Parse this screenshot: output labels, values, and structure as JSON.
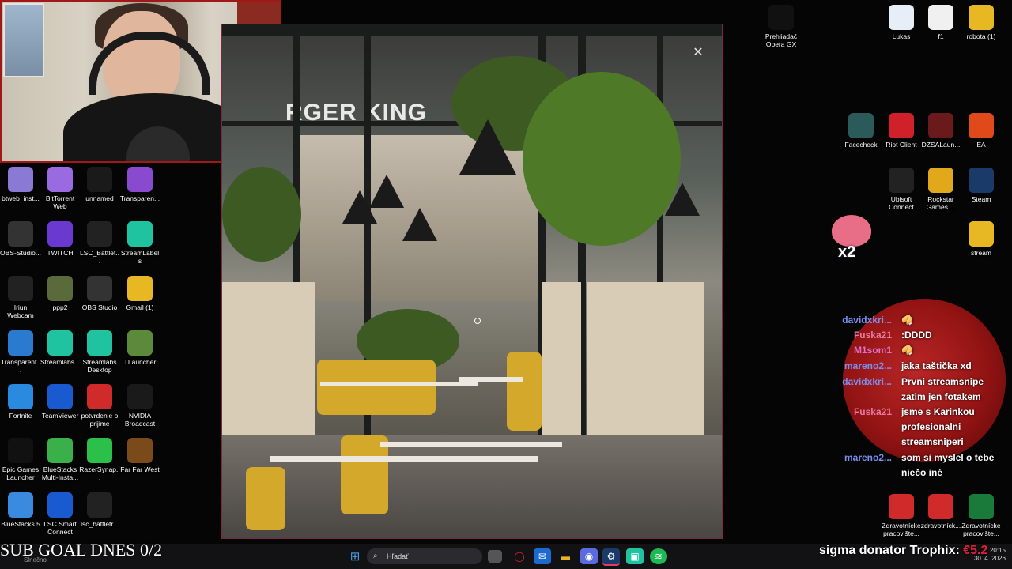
{
  "webcam": {
    "label": "webcam"
  },
  "viewer": {
    "sign": "RGER KING",
    "close": "✕"
  },
  "left_icons": [
    {
      "name": "btweb_inst...",
      "icon": "bittorrent-web-icon",
      "color": "#8a7ad6"
    },
    {
      "name": "BitTorrent Web",
      "icon": "bittorrent-web-icon",
      "color": "#9a6ae0"
    },
    {
      "name": "unnamed",
      "icon": "file-icon",
      "color": "#1a1a1a"
    },
    {
      "name": "Transparen...",
      "icon": "chat-bubble-icon",
      "color": "#8a4ad0"
    },
    {
      "name": "OBS-Studio...",
      "icon": "obs-icon",
      "color": "#333"
    },
    {
      "name": "TWITCH",
      "icon": "twitch-icon",
      "color": "#6a3ad0"
    },
    {
      "name": "LSC_Battlet...",
      "icon": "battlenet-icon",
      "color": "#222"
    },
    {
      "name": "StreamLabels",
      "icon": "streamlabs-icon",
      "color": "#1fc3a0"
    },
    {
      "name": "Iriun Webcam",
      "icon": "webcam-icon",
      "color": "#222"
    },
    {
      "name": "ppp2",
      "icon": "image-icon",
      "color": "#5a6a3a"
    },
    {
      "name": "OBS Studio",
      "icon": "obs-icon",
      "color": "#333"
    },
    {
      "name": "Gmail (1)",
      "icon": "folder-icon",
      "color": "#e8b824"
    },
    {
      "name": "Transparent...",
      "icon": "window-icon",
      "color": "#2a7ad0"
    },
    {
      "name": "Streamlabs...",
      "icon": "streamlabs-icon",
      "color": "#1fc3a0"
    },
    {
      "name": "Streamlabs Desktop",
      "icon": "streamlabs-icon",
      "color": "#1fc3a0"
    },
    {
      "name": "TLauncher",
      "icon": "minecraft-icon",
      "color": "#5a8a3a"
    },
    {
      "name": "Fortnite",
      "icon": "fortnite-icon",
      "color": "#2a8ae0"
    },
    {
      "name": "TeamViewer",
      "icon": "teamviewer-icon",
      "color": "#1a5ad0"
    },
    {
      "name": "potvrdenie o prijime",
      "icon": "pdf-icon",
      "color": "#d02a2a"
    },
    {
      "name": "NVIDIA Broadcast",
      "icon": "nvidia-icon",
      "color": "#1a1a1a"
    },
    {
      "name": "Epic Games Launcher",
      "icon": "epic-games-icon",
      "color": "#111"
    },
    {
      "name": "BlueStacks Multi-Insta...",
      "icon": "bluestacks-icon",
      "color": "#3ab04a"
    },
    {
      "name": "RazerSynap...",
      "icon": "razer-icon",
      "color": "#2ac04a"
    },
    {
      "name": "Far Far West",
      "icon": "game-icon",
      "color": "#7a4a1a"
    },
    {
      "name": "BlueStacks 5",
      "icon": "bluestacks-icon",
      "color": "#3a8ae0"
    },
    {
      "name": "LSC Smart Connect",
      "icon": "lsc-icon",
      "color": "#1a5ad0"
    },
    {
      "name": "lsc_battletr...",
      "icon": "battlenet-icon",
      "color": "#222"
    }
  ],
  "right_icons": [
    {
      "name": "Prehliadač Opera GX",
      "icon": "opera-gx-icon",
      "color": "#111"
    },
    {
      "name": "Lukas",
      "icon": "document-icon",
      "color": "#e8eef8"
    },
    {
      "name": "f1",
      "icon": "document-icon",
      "color": "#f0f0f0"
    },
    {
      "name": "robota (1)",
      "icon": "folder-icon",
      "color": "#e8b824"
    },
    {
      "name": "Facecheck",
      "icon": "facecheck-icon",
      "color": "#2a5a5a"
    },
    {
      "name": "Riot Client",
      "icon": "riot-icon",
      "color": "#d0202a"
    },
    {
      "name": "DZSALaun...",
      "icon": "dzsa-icon",
      "color": "#6a1a1a"
    },
    {
      "name": "EA",
      "icon": "ea-icon",
      "color": "#e04a1a"
    },
    {
      "name": "Ubisoft Connect",
      "icon": "ubisoft-icon",
      "color": "#222"
    },
    {
      "name": "Rockstar Games ...",
      "icon": "rockstar-icon",
      "color": "#e0a81a"
    },
    {
      "name": "Steam",
      "icon": "steam-icon",
      "color": "#1a3a6a"
    },
    {
      "name": "stream",
      "icon": "folder-icon",
      "color": "#e8b824"
    },
    {
      "name": "Zdravotnícke pracovište...",
      "icon": "pdf-icon",
      "color": "#d02a2a"
    },
    {
      "name": "zdravotníck...",
      "icon": "pdf-icon",
      "color": "#d02a2a"
    },
    {
      "name": "Zdravotnícke pracovište...",
      "icon": "excel-icon",
      "color": "#1a7a3a"
    }
  ],
  "chat": [
    {
      "user": "davidxkri...",
      "color": "#7b8ff0",
      "text": "🥠"
    },
    {
      "user": "Fuska21",
      "color": "#e87aa0",
      "text": ":DDDD"
    },
    {
      "user": "M1som1",
      "color": "#e070d0",
      "text": "🥠"
    },
    {
      "user": "mareno2...",
      "color": "#7b8ff0",
      "text": "jaka taštička xd"
    },
    {
      "user": "davidxkri...",
      "color": "#7b8ff0",
      "text": "Prvni streamsnipe zatim jen fotakem"
    },
    {
      "user": "Fuska21",
      "color": "#e87aa0",
      "text": "jsme s Karinkou profesionalni streamsniperi"
    },
    {
      "user": "mareno2...",
      "color": "#7b8ff0",
      "text": "som si myslel o tebe niečo iné"
    }
  ],
  "mascot": {
    "multiplier": "x2"
  },
  "overlay": {
    "sub_goal": "SUB GOAL DNES 0/2",
    "donator_label": "sigma donator Trophix:",
    "donator_amount": "€5.2"
  },
  "taskbar": {
    "weather": "Slnečno",
    "search_placeholder": "Hľadať",
    "time": "20:15",
    "date": "30. 4. 2026"
  }
}
